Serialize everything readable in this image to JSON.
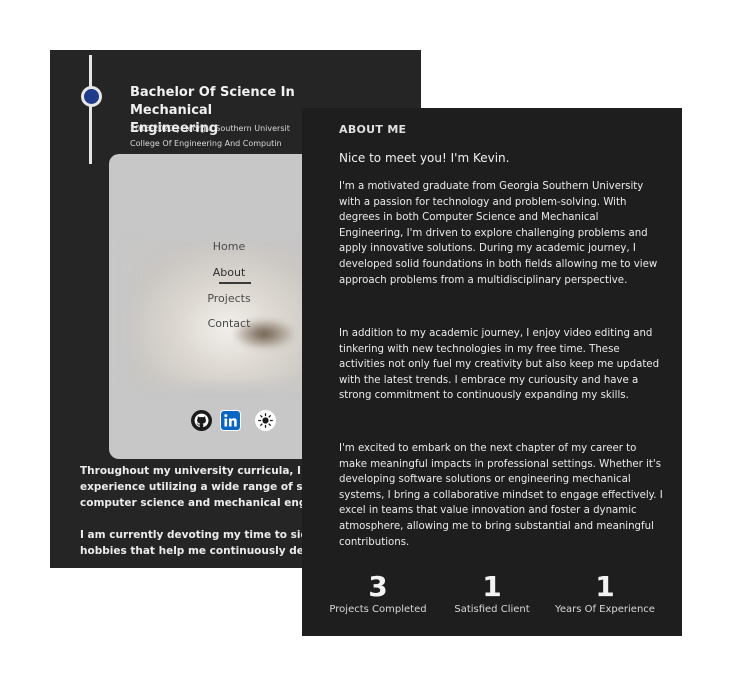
{
  "education": {
    "title_line1": "Bachelor Of Science In Mechanical",
    "title_line2": "Engineering",
    "years_school": "2016-2020 | Georgia Southern Universit",
    "college": "College Of Engineering And Computin"
  },
  "nav": {
    "items": [
      "Home",
      "About",
      "Projects",
      "Contact"
    ],
    "active": "About"
  },
  "social_icons": [
    "github-icon",
    "linkedin-icon",
    "sun-icon"
  ],
  "back_text": {
    "line1": "Throughout my university curricula, I gained",
    "line2": "experience utilizing a wide range of skills pe",
    "line3": "computer science and mechanical enginee",
    "line4": "I am currently devoting my time to side proj",
    "line5": "hobbies that help me continuously develop"
  },
  "about": {
    "heading": "ABOUT ME",
    "greeting": "Nice to meet you! I'm Kevin.",
    "paragraphs": [
      "I'm a motivated graduate from Georgia Southern University with a passion for technology and problem-solving. With degrees in both Computer Science and Mechanical Engineering, I'm driven to explore challenging problems and apply innovative solutions. During my academic journey, I developed solid foundations in both fields allowing me to view approach problems from a multidisciplinary perspective.",
      "In addition to my academic journey, I enjoy video editing and tinkering with new technologies in my free time. These activities not only fuel my creativity but also keep me updated with the latest trends. I embrace my curiousity and have a strong commitment to continuously expanding my skills.",
      "I'm excited to embark on the next chapter of my career to make meaningful impacts in professional settings. Whether it's developing software solutions or engineering mechanical systems, I bring a collaborative mindset to engage effectively. I excel in teams that value innovation and foster a dynamic atmosphere, allowing me to bring substantial and meaningful contributions."
    ]
  },
  "stats": [
    {
      "value": "3",
      "label": "Projects Completed"
    },
    {
      "value": "1",
      "label": "Satisfied Client"
    },
    {
      "value": "1",
      "label": "Years Of Experience"
    }
  ],
  "colors": {
    "panel_back": "#252525",
    "panel_front": "#1e1e1e",
    "timeline_dot": "#1f3c8a",
    "linkedin": "#0a66c2"
  }
}
